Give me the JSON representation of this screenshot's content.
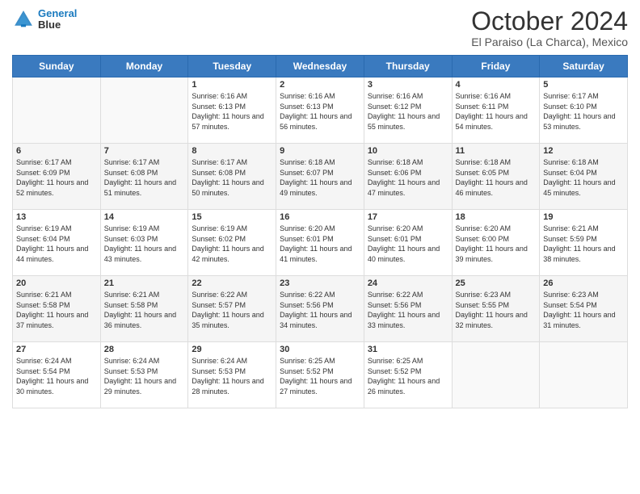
{
  "logo": {
    "line1": "General",
    "line2": "Blue"
  },
  "title": "October 2024",
  "location": "El Paraiso (La Charca), Mexico",
  "days_header": [
    "Sunday",
    "Monday",
    "Tuesday",
    "Wednesday",
    "Thursday",
    "Friday",
    "Saturday"
  ],
  "weeks": [
    [
      {
        "day": "",
        "sunrise": "",
        "sunset": "",
        "daylight": ""
      },
      {
        "day": "",
        "sunrise": "",
        "sunset": "",
        "daylight": ""
      },
      {
        "day": "1",
        "sunrise": "Sunrise: 6:16 AM",
        "sunset": "Sunset: 6:13 PM",
        "daylight": "Daylight: 11 hours and 57 minutes."
      },
      {
        "day": "2",
        "sunrise": "Sunrise: 6:16 AM",
        "sunset": "Sunset: 6:13 PM",
        "daylight": "Daylight: 11 hours and 56 minutes."
      },
      {
        "day": "3",
        "sunrise": "Sunrise: 6:16 AM",
        "sunset": "Sunset: 6:12 PM",
        "daylight": "Daylight: 11 hours and 55 minutes."
      },
      {
        "day": "4",
        "sunrise": "Sunrise: 6:16 AM",
        "sunset": "Sunset: 6:11 PM",
        "daylight": "Daylight: 11 hours and 54 minutes."
      },
      {
        "day": "5",
        "sunrise": "Sunrise: 6:17 AM",
        "sunset": "Sunset: 6:10 PM",
        "daylight": "Daylight: 11 hours and 53 minutes."
      }
    ],
    [
      {
        "day": "6",
        "sunrise": "Sunrise: 6:17 AM",
        "sunset": "Sunset: 6:09 PM",
        "daylight": "Daylight: 11 hours and 52 minutes."
      },
      {
        "day": "7",
        "sunrise": "Sunrise: 6:17 AM",
        "sunset": "Sunset: 6:08 PM",
        "daylight": "Daylight: 11 hours and 51 minutes."
      },
      {
        "day": "8",
        "sunrise": "Sunrise: 6:17 AM",
        "sunset": "Sunset: 6:08 PM",
        "daylight": "Daylight: 11 hours and 50 minutes."
      },
      {
        "day": "9",
        "sunrise": "Sunrise: 6:18 AM",
        "sunset": "Sunset: 6:07 PM",
        "daylight": "Daylight: 11 hours and 49 minutes."
      },
      {
        "day": "10",
        "sunrise": "Sunrise: 6:18 AM",
        "sunset": "Sunset: 6:06 PM",
        "daylight": "Daylight: 11 hours and 47 minutes."
      },
      {
        "day": "11",
        "sunrise": "Sunrise: 6:18 AM",
        "sunset": "Sunset: 6:05 PM",
        "daylight": "Daylight: 11 hours and 46 minutes."
      },
      {
        "day": "12",
        "sunrise": "Sunrise: 6:18 AM",
        "sunset": "Sunset: 6:04 PM",
        "daylight": "Daylight: 11 hours and 45 minutes."
      }
    ],
    [
      {
        "day": "13",
        "sunrise": "Sunrise: 6:19 AM",
        "sunset": "Sunset: 6:04 PM",
        "daylight": "Daylight: 11 hours and 44 minutes."
      },
      {
        "day": "14",
        "sunrise": "Sunrise: 6:19 AM",
        "sunset": "Sunset: 6:03 PM",
        "daylight": "Daylight: 11 hours and 43 minutes."
      },
      {
        "day": "15",
        "sunrise": "Sunrise: 6:19 AM",
        "sunset": "Sunset: 6:02 PM",
        "daylight": "Daylight: 11 hours and 42 minutes."
      },
      {
        "day": "16",
        "sunrise": "Sunrise: 6:20 AM",
        "sunset": "Sunset: 6:01 PM",
        "daylight": "Daylight: 11 hours and 41 minutes."
      },
      {
        "day": "17",
        "sunrise": "Sunrise: 6:20 AM",
        "sunset": "Sunset: 6:01 PM",
        "daylight": "Daylight: 11 hours and 40 minutes."
      },
      {
        "day": "18",
        "sunrise": "Sunrise: 6:20 AM",
        "sunset": "Sunset: 6:00 PM",
        "daylight": "Daylight: 11 hours and 39 minutes."
      },
      {
        "day": "19",
        "sunrise": "Sunrise: 6:21 AM",
        "sunset": "Sunset: 5:59 PM",
        "daylight": "Daylight: 11 hours and 38 minutes."
      }
    ],
    [
      {
        "day": "20",
        "sunrise": "Sunrise: 6:21 AM",
        "sunset": "Sunset: 5:58 PM",
        "daylight": "Daylight: 11 hours and 37 minutes."
      },
      {
        "day": "21",
        "sunrise": "Sunrise: 6:21 AM",
        "sunset": "Sunset: 5:58 PM",
        "daylight": "Daylight: 11 hours and 36 minutes."
      },
      {
        "day": "22",
        "sunrise": "Sunrise: 6:22 AM",
        "sunset": "Sunset: 5:57 PM",
        "daylight": "Daylight: 11 hours and 35 minutes."
      },
      {
        "day": "23",
        "sunrise": "Sunrise: 6:22 AM",
        "sunset": "Sunset: 5:56 PM",
        "daylight": "Daylight: 11 hours and 34 minutes."
      },
      {
        "day": "24",
        "sunrise": "Sunrise: 6:22 AM",
        "sunset": "Sunset: 5:56 PM",
        "daylight": "Daylight: 11 hours and 33 minutes."
      },
      {
        "day": "25",
        "sunrise": "Sunrise: 6:23 AM",
        "sunset": "Sunset: 5:55 PM",
        "daylight": "Daylight: 11 hours and 32 minutes."
      },
      {
        "day": "26",
        "sunrise": "Sunrise: 6:23 AM",
        "sunset": "Sunset: 5:54 PM",
        "daylight": "Daylight: 11 hours and 31 minutes."
      }
    ],
    [
      {
        "day": "27",
        "sunrise": "Sunrise: 6:24 AM",
        "sunset": "Sunset: 5:54 PM",
        "daylight": "Daylight: 11 hours and 30 minutes."
      },
      {
        "day": "28",
        "sunrise": "Sunrise: 6:24 AM",
        "sunset": "Sunset: 5:53 PM",
        "daylight": "Daylight: 11 hours and 29 minutes."
      },
      {
        "day": "29",
        "sunrise": "Sunrise: 6:24 AM",
        "sunset": "Sunset: 5:53 PM",
        "daylight": "Daylight: 11 hours and 28 minutes."
      },
      {
        "day": "30",
        "sunrise": "Sunrise: 6:25 AM",
        "sunset": "Sunset: 5:52 PM",
        "daylight": "Daylight: 11 hours and 27 minutes."
      },
      {
        "day": "31",
        "sunrise": "Sunrise: 6:25 AM",
        "sunset": "Sunset: 5:52 PM",
        "daylight": "Daylight: 11 hours and 26 minutes."
      },
      {
        "day": "",
        "sunrise": "",
        "sunset": "",
        "daylight": ""
      },
      {
        "day": "",
        "sunrise": "",
        "sunset": "",
        "daylight": ""
      }
    ]
  ]
}
